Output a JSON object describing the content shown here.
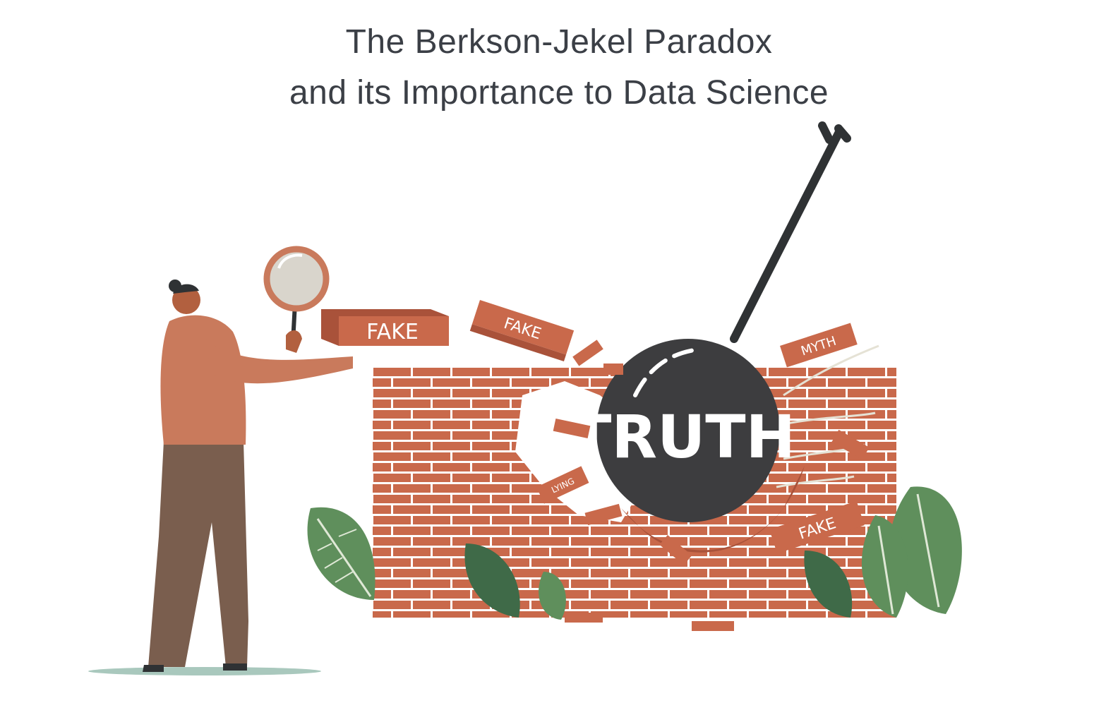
{
  "title": {
    "line1": "The Berkson-Jekel Paradox",
    "line2": "and its Importance to Data Science"
  },
  "illustration": {
    "ball_label": "TRUTH",
    "brick_labels": {
      "held": "FAKE",
      "flying_left": "FAKE",
      "flying_right": "MYTH",
      "small": "LYING",
      "bottom_right": "FAKE"
    },
    "colors": {
      "brick": "#c9694b",
      "brick_dark": "#a9523a",
      "mortar": "#ffffff",
      "ball": "#3d3d3f",
      "chain": "#2f3234",
      "leaf": "#5f8f5c",
      "leaf_dark": "#3f6a48",
      "shirt": "#c97a5c",
      "pants": "#7a5e4e",
      "skin": "#b2603f"
    }
  }
}
